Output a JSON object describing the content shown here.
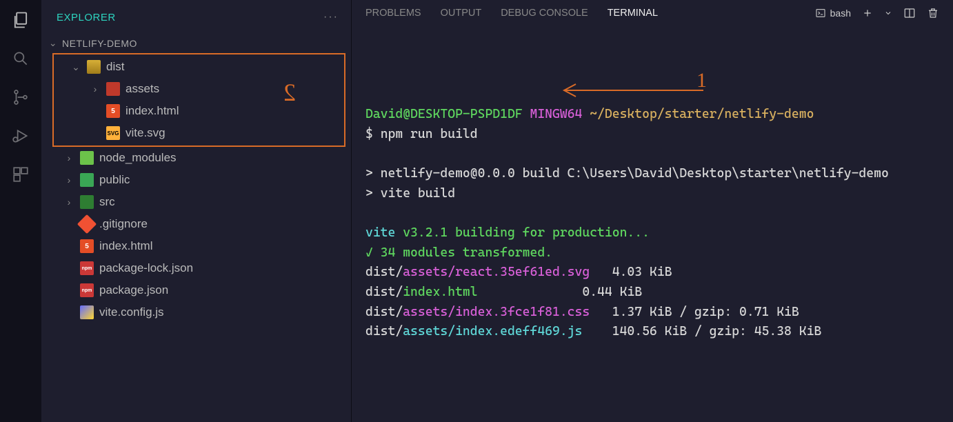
{
  "sidebar": {
    "title": "EXPLORER",
    "root": "NETLIFY-DEMO",
    "tree": {
      "dist": "dist",
      "assets": "assets",
      "index_html": "index.html",
      "vite_svg": "vite.svg",
      "node_modules": "node_modules",
      "public": "public",
      "src": "src",
      "gitignore": ".gitignore",
      "root_index_html": "index.html",
      "package_lock": "package-lock.json",
      "package_json": "package.json",
      "vite_config": "vite.config.js"
    }
  },
  "panel": {
    "tabs": {
      "problems": "PROBLEMS",
      "output": "OUTPUT",
      "debug": "DEBUG CONSOLE",
      "terminal": "TERMINAL"
    },
    "shell": "bash"
  },
  "terminal": {
    "user_host": "David@DESKTOP-PSPD1DF",
    "mingw": "MINGW64",
    "cwd": "~/Desktop/starter/netlify-demo",
    "prompt_symbol": "$",
    "cmd": "npm run build",
    "script_header": "> netlify-demo@0.0.0 build C:\\Users\\David\\Desktop\\starter\\netlify-demo",
    "script_cmd": "> vite build",
    "vite_tag": "vite",
    "vite_version": "v3.2.1",
    "build_msg": "building for production...",
    "transform_msg": "✓ 34 modules transformed.",
    "outputs": [
      {
        "prefix": "dist/",
        "path": "assets/react.35ef61ed.svg",
        "size": "4.03 KiB",
        "extra": ""
      },
      {
        "prefix": "dist/",
        "path": "index.html",
        "size": "0.44 KiB",
        "extra": ""
      },
      {
        "prefix": "dist/",
        "path": "assets/index.3fce1f81.css",
        "size": "1.37 KiB",
        "extra": "/ gzip: 0.71 KiB"
      },
      {
        "prefix": "dist/",
        "path": "assets/index.edeff469.js",
        "size": "140.56 KiB",
        "extra": "/ gzip: 45.38 KiB"
      }
    ]
  },
  "annotations": {
    "two": "2",
    "one": "1"
  }
}
